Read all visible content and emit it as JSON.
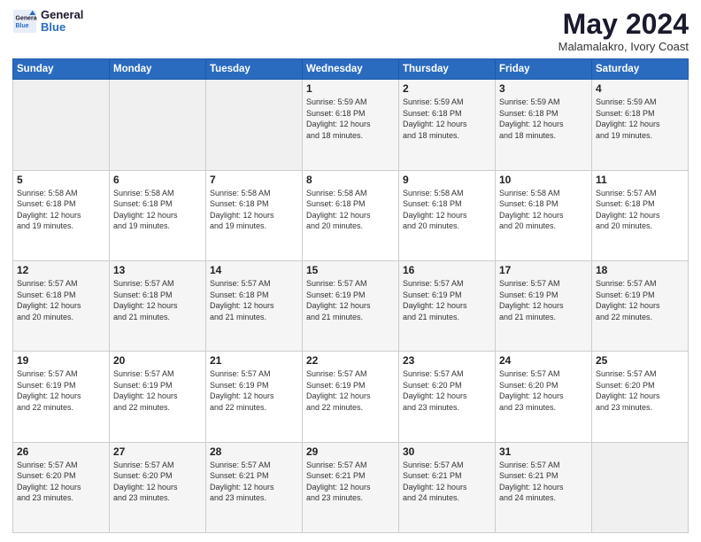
{
  "header": {
    "logo_line1": "General",
    "logo_line2": "Blue",
    "month_year": "May 2024",
    "location": "Malamalakro, Ivory Coast"
  },
  "weekdays": [
    "Sunday",
    "Monday",
    "Tuesday",
    "Wednesday",
    "Thursday",
    "Friday",
    "Saturday"
  ],
  "weeks": [
    [
      {
        "day": "",
        "info": ""
      },
      {
        "day": "",
        "info": ""
      },
      {
        "day": "",
        "info": ""
      },
      {
        "day": "1",
        "info": "Sunrise: 5:59 AM\nSunset: 6:18 PM\nDaylight: 12 hours\nand 18 minutes."
      },
      {
        "day": "2",
        "info": "Sunrise: 5:59 AM\nSunset: 6:18 PM\nDaylight: 12 hours\nand 18 minutes."
      },
      {
        "day": "3",
        "info": "Sunrise: 5:59 AM\nSunset: 6:18 PM\nDaylight: 12 hours\nand 18 minutes."
      },
      {
        "day": "4",
        "info": "Sunrise: 5:59 AM\nSunset: 6:18 PM\nDaylight: 12 hours\nand 19 minutes."
      }
    ],
    [
      {
        "day": "5",
        "info": "Sunrise: 5:58 AM\nSunset: 6:18 PM\nDaylight: 12 hours\nand 19 minutes."
      },
      {
        "day": "6",
        "info": "Sunrise: 5:58 AM\nSunset: 6:18 PM\nDaylight: 12 hours\nand 19 minutes."
      },
      {
        "day": "7",
        "info": "Sunrise: 5:58 AM\nSunset: 6:18 PM\nDaylight: 12 hours\nand 19 minutes."
      },
      {
        "day": "8",
        "info": "Sunrise: 5:58 AM\nSunset: 6:18 PM\nDaylight: 12 hours\nand 20 minutes."
      },
      {
        "day": "9",
        "info": "Sunrise: 5:58 AM\nSunset: 6:18 PM\nDaylight: 12 hours\nand 20 minutes."
      },
      {
        "day": "10",
        "info": "Sunrise: 5:58 AM\nSunset: 6:18 PM\nDaylight: 12 hours\nand 20 minutes."
      },
      {
        "day": "11",
        "info": "Sunrise: 5:57 AM\nSunset: 6:18 PM\nDaylight: 12 hours\nand 20 minutes."
      }
    ],
    [
      {
        "day": "12",
        "info": "Sunrise: 5:57 AM\nSunset: 6:18 PM\nDaylight: 12 hours\nand 20 minutes."
      },
      {
        "day": "13",
        "info": "Sunrise: 5:57 AM\nSunset: 6:18 PM\nDaylight: 12 hours\nand 21 minutes."
      },
      {
        "day": "14",
        "info": "Sunrise: 5:57 AM\nSunset: 6:18 PM\nDaylight: 12 hours\nand 21 minutes."
      },
      {
        "day": "15",
        "info": "Sunrise: 5:57 AM\nSunset: 6:19 PM\nDaylight: 12 hours\nand 21 minutes."
      },
      {
        "day": "16",
        "info": "Sunrise: 5:57 AM\nSunset: 6:19 PM\nDaylight: 12 hours\nand 21 minutes."
      },
      {
        "day": "17",
        "info": "Sunrise: 5:57 AM\nSunset: 6:19 PM\nDaylight: 12 hours\nand 21 minutes."
      },
      {
        "day": "18",
        "info": "Sunrise: 5:57 AM\nSunset: 6:19 PM\nDaylight: 12 hours\nand 22 minutes."
      }
    ],
    [
      {
        "day": "19",
        "info": "Sunrise: 5:57 AM\nSunset: 6:19 PM\nDaylight: 12 hours\nand 22 minutes."
      },
      {
        "day": "20",
        "info": "Sunrise: 5:57 AM\nSunset: 6:19 PM\nDaylight: 12 hours\nand 22 minutes."
      },
      {
        "day": "21",
        "info": "Sunrise: 5:57 AM\nSunset: 6:19 PM\nDaylight: 12 hours\nand 22 minutes."
      },
      {
        "day": "22",
        "info": "Sunrise: 5:57 AM\nSunset: 6:19 PM\nDaylight: 12 hours\nand 22 minutes."
      },
      {
        "day": "23",
        "info": "Sunrise: 5:57 AM\nSunset: 6:20 PM\nDaylight: 12 hours\nand 23 minutes."
      },
      {
        "day": "24",
        "info": "Sunrise: 5:57 AM\nSunset: 6:20 PM\nDaylight: 12 hours\nand 23 minutes."
      },
      {
        "day": "25",
        "info": "Sunrise: 5:57 AM\nSunset: 6:20 PM\nDaylight: 12 hours\nand 23 minutes."
      }
    ],
    [
      {
        "day": "26",
        "info": "Sunrise: 5:57 AM\nSunset: 6:20 PM\nDaylight: 12 hours\nand 23 minutes."
      },
      {
        "day": "27",
        "info": "Sunrise: 5:57 AM\nSunset: 6:20 PM\nDaylight: 12 hours\nand 23 minutes."
      },
      {
        "day": "28",
        "info": "Sunrise: 5:57 AM\nSunset: 6:21 PM\nDaylight: 12 hours\nand 23 minutes."
      },
      {
        "day": "29",
        "info": "Sunrise: 5:57 AM\nSunset: 6:21 PM\nDaylight: 12 hours\nand 23 minutes."
      },
      {
        "day": "30",
        "info": "Sunrise: 5:57 AM\nSunset: 6:21 PM\nDaylight: 12 hours\nand 24 minutes."
      },
      {
        "day": "31",
        "info": "Sunrise: 5:57 AM\nSunset: 6:21 PM\nDaylight: 12 hours\nand 24 minutes."
      },
      {
        "day": "",
        "info": ""
      }
    ]
  ]
}
